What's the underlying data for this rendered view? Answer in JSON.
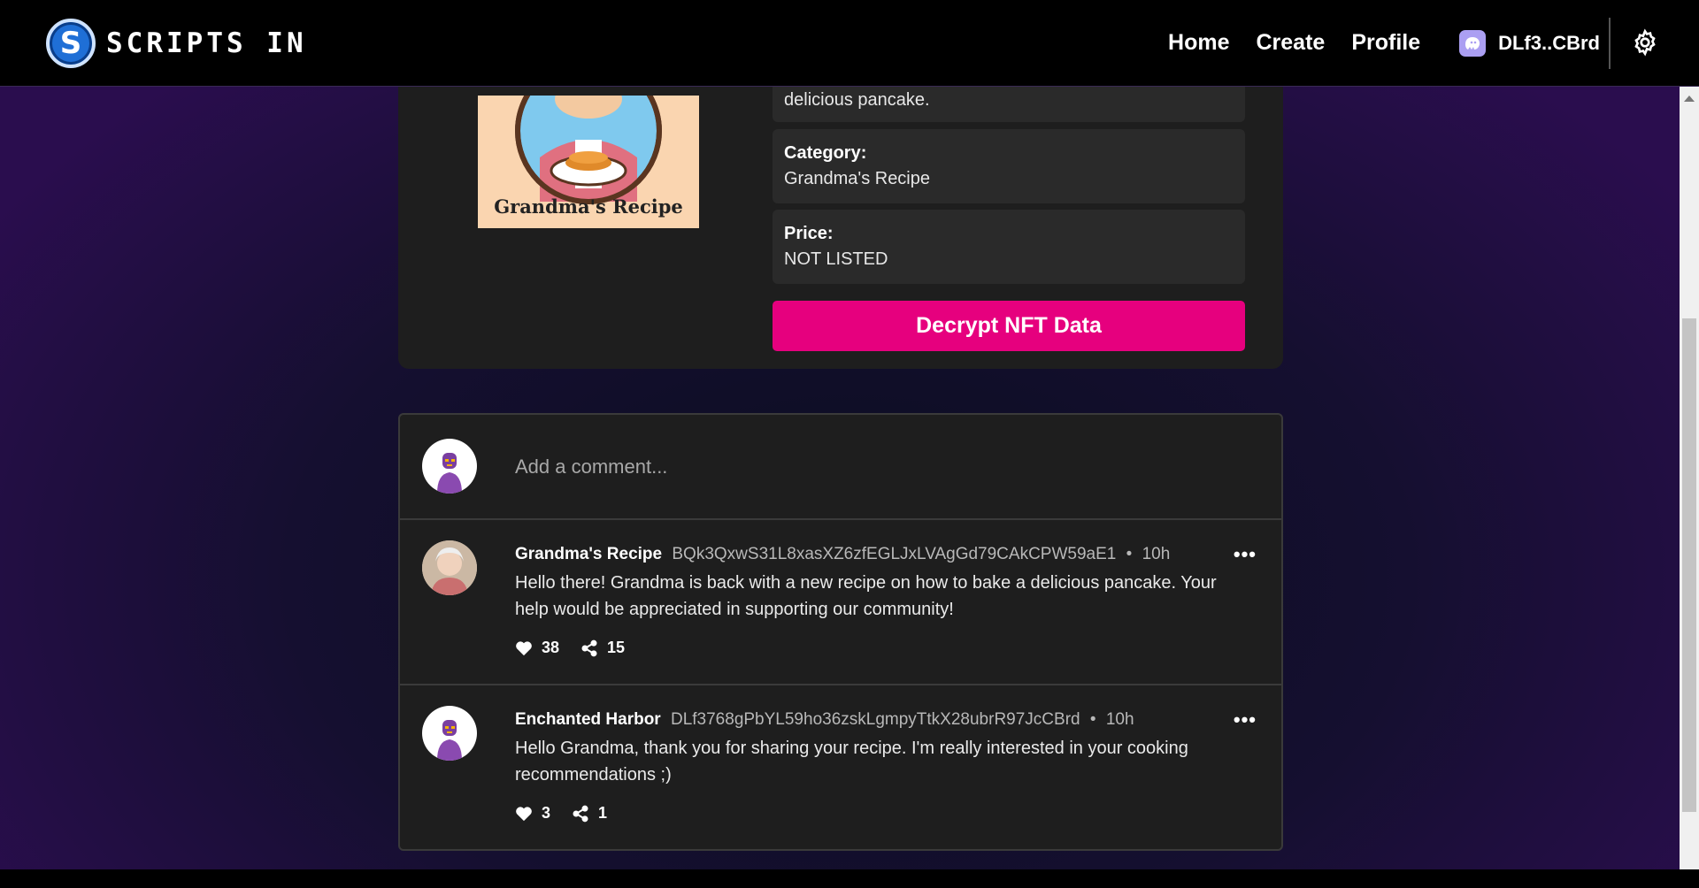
{
  "brand": {
    "name": "SCRIPTS IN",
    "logo_letter": "S"
  },
  "nav": {
    "home": "Home",
    "create": "Create",
    "profile": "Profile",
    "wallet": "DLf3..CBrd"
  },
  "nft": {
    "image_caption": "Grandma's Recipe",
    "description_tail": "delicious pancake.",
    "category_label": "Category:",
    "category_value": "Grandma's Recipe",
    "price_label": "Price:",
    "price_value": "NOT LISTED",
    "decrypt_label": "Decrypt NFT Data"
  },
  "composer": {
    "placeholder": "Add a comment..."
  },
  "comments": [
    {
      "author": "Grandma's Recipe",
      "address": "BQk3QxwS31L8xasXZ6zfEGLJxLVAgGd79CAkCPW59aE1",
      "separator": "•",
      "time": "10h",
      "text": "Hello there! Grandma is back with a new recipe on how to bake a delicious pancake. Your help would be appreciated in supporting our community!",
      "likes": "38",
      "shares": "15",
      "more": "•••"
    },
    {
      "author": "Enchanted Harbor",
      "address": "DLf3768gPbYL59ho36zskLgmpyTtkX28ubrR97JcCBrd",
      "separator": "•",
      "time": "10h",
      "text": "Hello Grandma, thank you for sharing your recipe. I'm really interested in your cooking recommendations ;)",
      "likes": "3",
      "shares": "1",
      "more": "•••"
    }
  ],
  "colors": {
    "accent": "#e6007e",
    "card": "#1e1e1e",
    "box": "#2a2a2a",
    "wallet_icon": "#ab9ff2"
  }
}
